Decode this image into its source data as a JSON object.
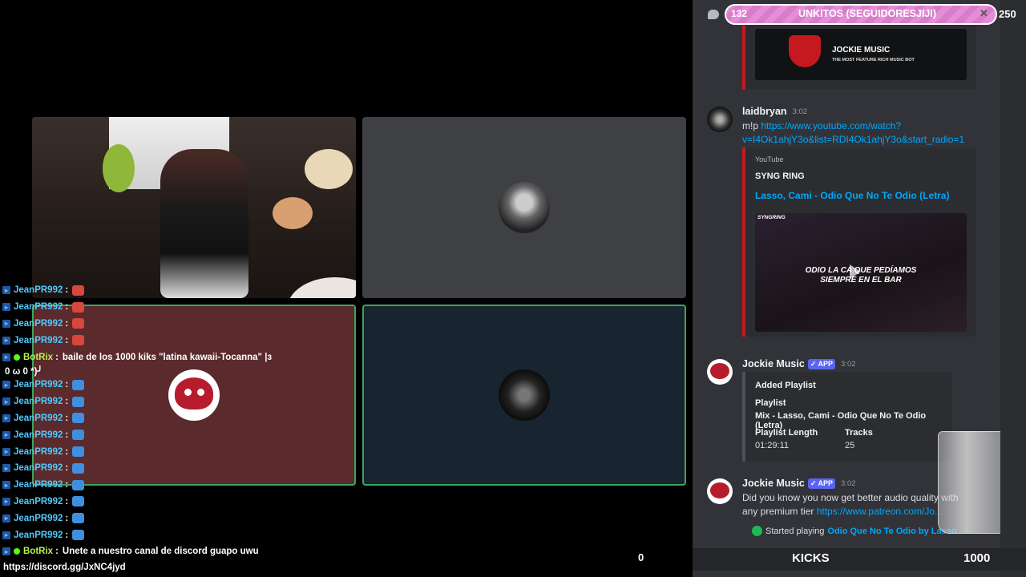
{
  "chat": {
    "lines": [
      {
        "user": "JeanPR992",
        "emote": "red"
      },
      {
        "user": "JeanPR992",
        "emote": "red"
      },
      {
        "user": "JeanPR992",
        "emote": "red"
      },
      {
        "user": "JeanPR992",
        "emote": "red"
      },
      {
        "user": "BotRix",
        "text": "baile de los 1000 kiks \"latina kawaii-Tocanna\" |з",
        "wrap": "0 ω 0 *)╯"
      },
      {
        "user": "JeanPR992",
        "emote": "blue"
      },
      {
        "user": "JeanPR992",
        "emote": "blue"
      },
      {
        "user": "JeanPR992",
        "emote": "blue"
      },
      {
        "user": "JeanPR992",
        "emote": "blue"
      },
      {
        "user": "JeanPR992",
        "emote": "blue"
      },
      {
        "user": "JeanPR992",
        "emote": "blue"
      },
      {
        "user": "JeanPR992",
        "emote": "blue"
      },
      {
        "user": "JeanPR992",
        "emote": "blue"
      },
      {
        "user": "JeanPR992",
        "emote": "blue"
      },
      {
        "user": "JeanPR992",
        "emote": "blue"
      },
      {
        "user": "BotRix",
        "text": "Unete a nuestro canal de discord guapo uwu",
        "wrap": "https://discord.gg/JxNC4jyd"
      }
    ],
    "separator": ":"
  },
  "counter_zero": "0",
  "banner": {
    "left_value": "132",
    "title": "UNKITOS (SEGUIDORESJIJI)",
    "close": "✕",
    "right_value": "250"
  },
  "discord": {
    "jockie_embed": {
      "title": "JOCKIE MUSIC",
      "subtitle": "THE MOST FEATURE RICH MUSIC BOT"
    },
    "msg1": {
      "author": "laidbryan",
      "time": "3:02",
      "prefix": "m!p",
      "link_line1": "https://www.youtube.com/watch?",
      "link_line2": "v=I4Ok1ahjY3o&list=RDI4Ok1ahjY3o&start_radio=1"
    },
    "yt": {
      "provider": "YouTube",
      "author": "SYNG RING",
      "title": "Lasso, Cami - Odio Que No Te Odio (Letra)",
      "thumb_brand": "SYNGRING",
      "thumb_caption_1": "ODIO LA CA      QUE PEDÍAMOS",
      "thumb_caption_2": "SIEMPRE EN EL BAR"
    },
    "msg2": {
      "author": "Jockie Music",
      "badge": "✓ APP",
      "time": "3:02",
      "added": "Added Playlist",
      "playlist_label": "Playlist",
      "playlist_value": "Mix - Lasso, Cami - Odio Que No Te Odio (Letra)",
      "length_label": "Playlist Length",
      "length_value": "01:29:11",
      "tracks_label": "Tracks",
      "tracks_value": "25"
    },
    "msg3": {
      "author": "Jockie Music",
      "badge": "✓ APP",
      "time": "3:02",
      "body1": "Did you know you now get better audio quality with",
      "body2_prefix": "any premium tier ",
      "body2_link": "https://www.patreon.com/Jo...",
      "now_playing_prefix": "Started playing ",
      "now_playing_song": "Odio Que No Te Odio by Lasso"
    }
  },
  "kicks": {
    "label": "KICKS",
    "goal": "1000"
  },
  "colors": {
    "kick_green": "#53fc18",
    "discord_bg": "#313338",
    "link": "#00a8fc",
    "speaking_border": "#3ba55c"
  }
}
